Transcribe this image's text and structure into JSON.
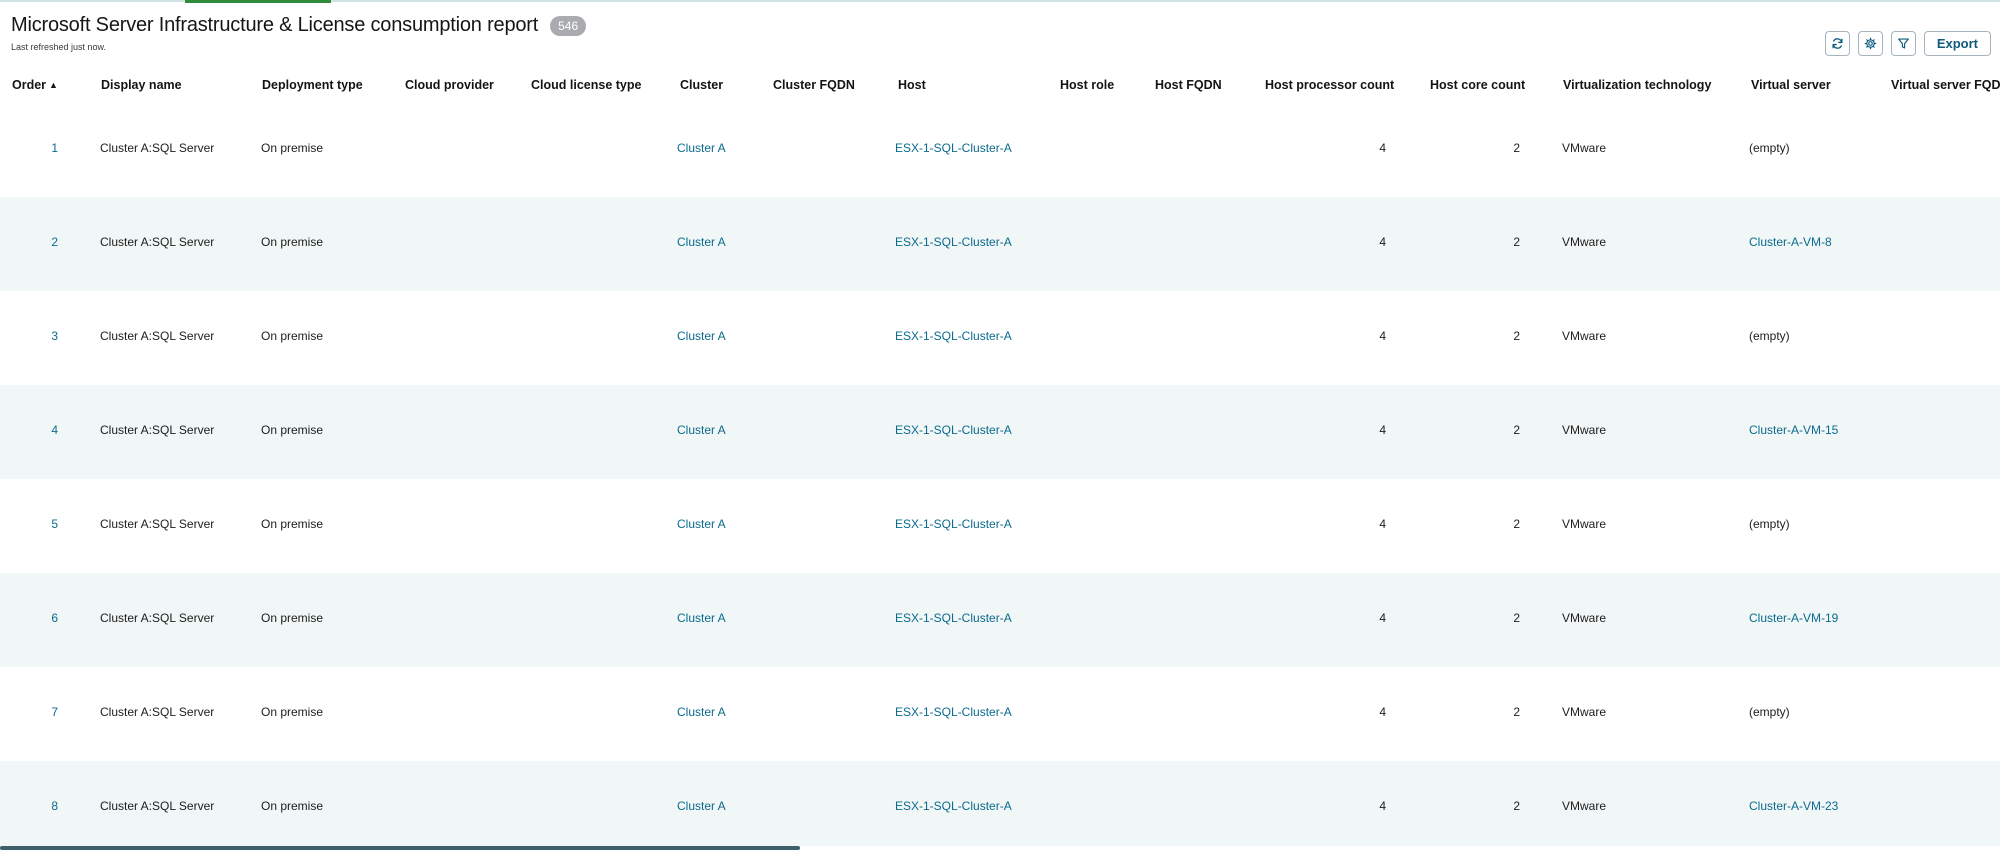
{
  "report": {
    "title": "Microsoft Server Infrastructure & License consumption report",
    "count": "546",
    "subtitle": "Last refreshed just now."
  },
  "toolbar": {
    "refresh_icon": "refresh-icon",
    "settings_icon": "gear-icon",
    "filter_icon": "filter-icon",
    "export_label": "Export"
  },
  "colors": {
    "link": "#0b6a8f",
    "alt_row": "#f1f6f6",
    "badge": "#a9abae",
    "accent": "#2e8b3a"
  },
  "table": {
    "columns": [
      "Order",
      "Display name",
      "Deployment type",
      "Cloud provider",
      "Cloud license type",
      "Cluster",
      "Cluster FQDN",
      "Host",
      "Host role",
      "Host FQDN",
      "Host processor count",
      "Host core count",
      "Virtualization technology",
      "Virtual server",
      "Virtual server FQDN"
    ],
    "sort": {
      "column": "Order",
      "direction": "ascending"
    },
    "rows": [
      {
        "order": "1",
        "display_name": "Cluster A:SQL Server",
        "deployment_type": "On premise",
        "cloud_provider": "",
        "cloud_license_type": "",
        "cluster": "Cluster A",
        "cluster_fqdn": "",
        "host": "ESX-1-SQL-Cluster-A",
        "host_role": "",
        "host_fqdn": "",
        "host_processor_count": "4",
        "host_core_count": "2",
        "virtualization": "VMware",
        "virtual_server": "(empty)",
        "virtual_server_fqdn": ""
      },
      {
        "order": "2",
        "display_name": "Cluster A:SQL Server",
        "deployment_type": "On premise",
        "cloud_provider": "",
        "cloud_license_type": "",
        "cluster": "Cluster A",
        "cluster_fqdn": "",
        "host": "ESX-1-SQL-Cluster-A",
        "host_role": "",
        "host_fqdn": "",
        "host_processor_count": "4",
        "host_core_count": "2",
        "virtualization": "VMware",
        "virtual_server": "Cluster-A-VM-8",
        "virtual_server_fqdn": ""
      },
      {
        "order": "3",
        "display_name": "Cluster A:SQL Server",
        "deployment_type": "On premise",
        "cloud_provider": "",
        "cloud_license_type": "",
        "cluster": "Cluster A",
        "cluster_fqdn": "",
        "host": "ESX-1-SQL-Cluster-A",
        "host_role": "",
        "host_fqdn": "",
        "host_processor_count": "4",
        "host_core_count": "2",
        "virtualization": "VMware",
        "virtual_server": "(empty)",
        "virtual_server_fqdn": ""
      },
      {
        "order": "4",
        "display_name": "Cluster A:SQL Server",
        "deployment_type": "On premise",
        "cloud_provider": "",
        "cloud_license_type": "",
        "cluster": "Cluster A",
        "cluster_fqdn": "",
        "host": "ESX-1-SQL-Cluster-A",
        "host_role": "",
        "host_fqdn": "",
        "host_processor_count": "4",
        "host_core_count": "2",
        "virtualization": "VMware",
        "virtual_server": "Cluster-A-VM-15",
        "virtual_server_fqdn": ""
      },
      {
        "order": "5",
        "display_name": "Cluster A:SQL Server",
        "deployment_type": "On premise",
        "cloud_provider": "",
        "cloud_license_type": "",
        "cluster": "Cluster A",
        "cluster_fqdn": "",
        "host": "ESX-1-SQL-Cluster-A",
        "host_role": "",
        "host_fqdn": "",
        "host_processor_count": "4",
        "host_core_count": "2",
        "virtualization": "VMware",
        "virtual_server": "(empty)",
        "virtual_server_fqdn": ""
      },
      {
        "order": "6",
        "display_name": "Cluster A:SQL Server",
        "deployment_type": "On premise",
        "cloud_provider": "",
        "cloud_license_type": "",
        "cluster": "Cluster A",
        "cluster_fqdn": "",
        "host": "ESX-1-SQL-Cluster-A",
        "host_role": "",
        "host_fqdn": "",
        "host_processor_count": "4",
        "host_core_count": "2",
        "virtualization": "VMware",
        "virtual_server": "Cluster-A-VM-19",
        "virtual_server_fqdn": ""
      },
      {
        "order": "7",
        "display_name": "Cluster A:SQL Server",
        "deployment_type": "On premise",
        "cloud_provider": "",
        "cloud_license_type": "",
        "cluster": "Cluster A",
        "cluster_fqdn": "",
        "host": "ESX-1-SQL-Cluster-A",
        "host_role": "",
        "host_fqdn": "",
        "host_processor_count": "4",
        "host_core_count": "2",
        "virtualization": "VMware",
        "virtual_server": "(empty)",
        "virtual_server_fqdn": ""
      },
      {
        "order": "8",
        "display_name": "Cluster A:SQL Server",
        "deployment_type": "On premise",
        "cloud_provider": "",
        "cloud_license_type": "",
        "cluster": "Cluster A",
        "cluster_fqdn": "",
        "host": "ESX-1-SQL-Cluster-A",
        "host_role": "",
        "host_fqdn": "",
        "host_processor_count": "4",
        "host_core_count": "2",
        "virtualization": "VMware",
        "virtual_server": "Cluster-A-VM-23",
        "virtual_server_fqdn": ""
      }
    ]
  }
}
